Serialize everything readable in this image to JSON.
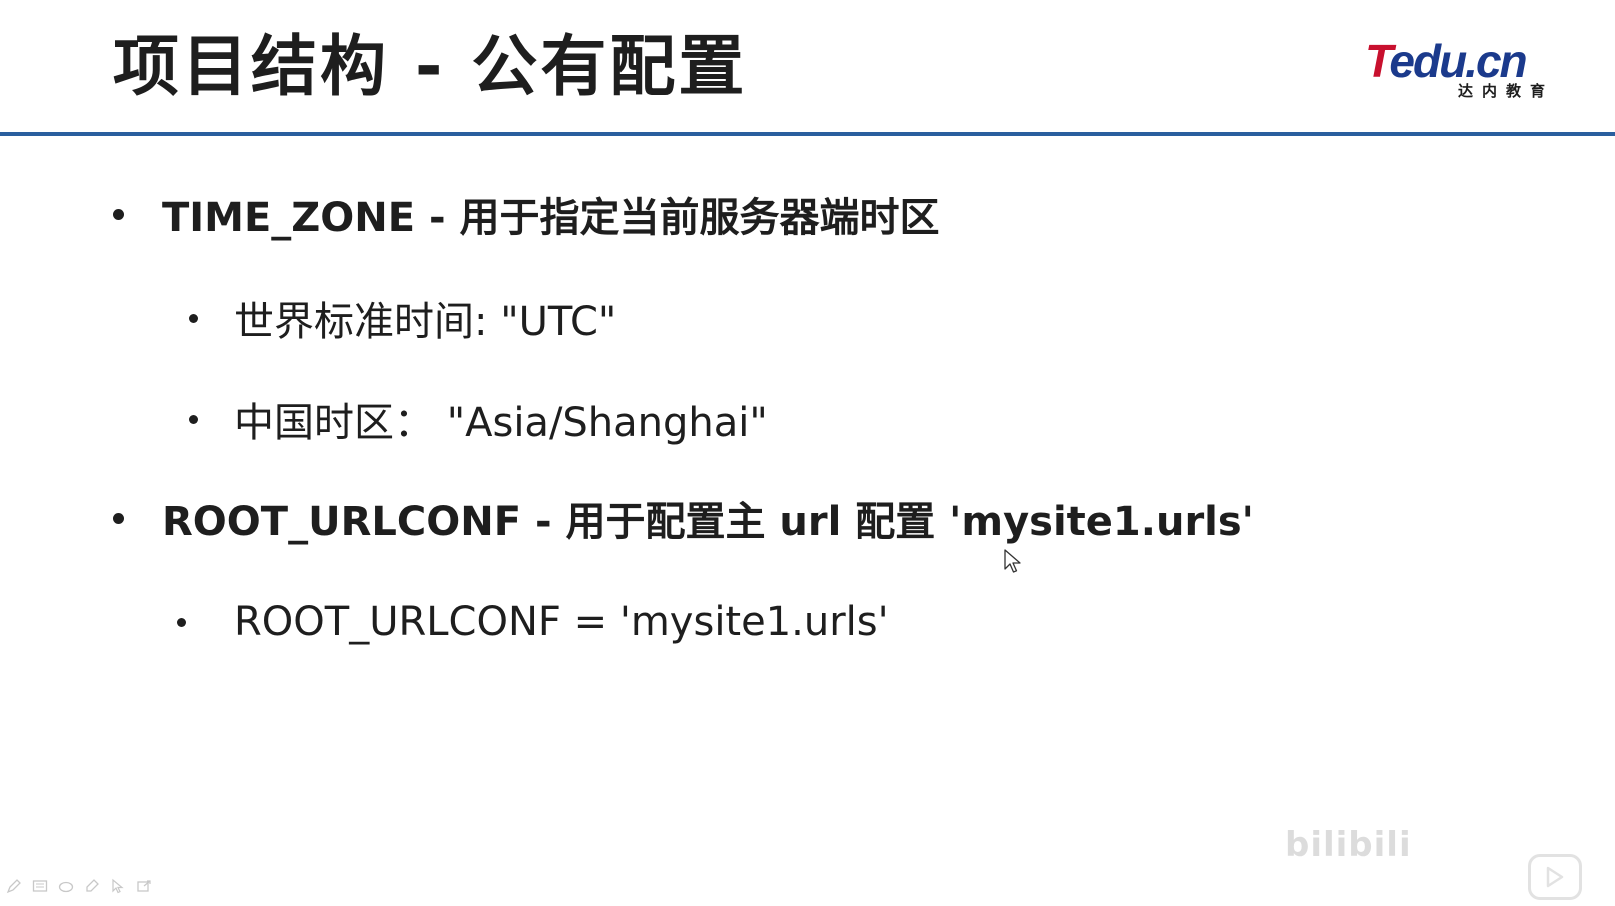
{
  "slide": {
    "title": "项目结构 - 公有配置"
  },
  "logo": {
    "brand_first": "T",
    "brand_rest": "edu.cn",
    "subtitle": "达内教育"
  },
  "bullets": [
    {
      "level": 1,
      "text": "TIME_ZONE - 用于指定当前服务器端时区"
    },
    {
      "level": 2,
      "text": "世界标准时间:  \"UTC\""
    },
    {
      "level": 2,
      "text": "中国时区：  \"Asia/Shanghai\""
    },
    {
      "level": 1,
      "text": " ROOT_URLCONF - 用于配置主 url 配置 'mysite1.urls'"
    },
    {
      "level": 2,
      "text": "ROOT_URLCONF = 'mysite1.urls'"
    }
  ],
  "watermark": {
    "text": "bilibili"
  },
  "icons": {
    "toolbar": [
      "pen-icon",
      "screen-icon",
      "eraser-icon",
      "highlighter-icon",
      "pointer-icon",
      "share-icon"
    ],
    "cursor": "mouse-cursor-icon",
    "play": "play-icon"
  },
  "colors": {
    "rule": "#2a5f9e",
    "logo_red": "#c8102e",
    "logo_blue": "#1b3a8c",
    "text": "#1e1e1e"
  }
}
